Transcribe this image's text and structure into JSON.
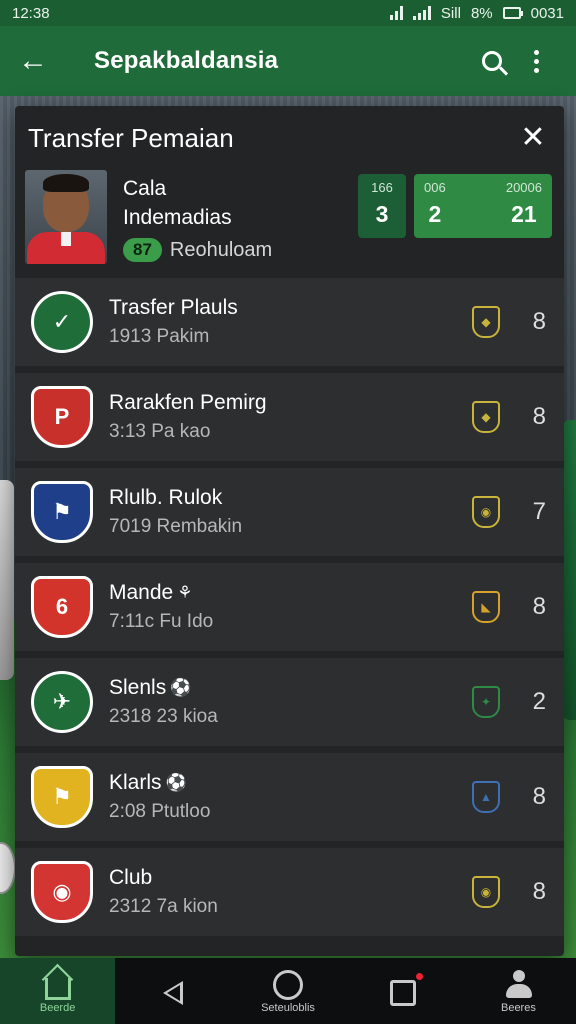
{
  "status": {
    "time": "12:38",
    "network": "Sill",
    "battery": "8%",
    "clock_right": "0031"
  },
  "appbar": {
    "title": "Sepakbaldansia"
  },
  "panel": {
    "title": "Transfer Pemaian",
    "player": {
      "name_line1": "Cala",
      "name_line2": "Indemadias",
      "rating": "87",
      "status": "Reohuloam"
    },
    "stats": [
      {
        "label": "166",
        "value": "3"
      },
      {
        "label": "006",
        "value": "2"
      },
      {
        "label": "20006",
        "value": "21"
      }
    ]
  },
  "clubs": [
    {
      "name": "Trasfer Plauls",
      "sub": "1913  Pakim",
      "num": "8",
      "emoji": "",
      "crest_color": "#1f6e3a",
      "crest_text": "✓",
      "mini_color": "#c8b43a"
    },
    {
      "name": "Rarakfen Pemirg",
      "sub": "3:13  Pa kao",
      "num": "8",
      "emoji": "",
      "crest_color": "#c8302c",
      "crest_text": "P",
      "mini_color": "#c8b43a"
    },
    {
      "name": "Rlulb. Rulok",
      "sub": "7019  Rembakin",
      "num": "7",
      "emoji": "",
      "crest_color": "#1f3f8a",
      "crest_text": "⚑",
      "mini_color": "#c8b43a"
    },
    {
      "name": "Mande",
      "sub": "7:11c  Fu Ido",
      "num": "8",
      "emoji": "⚘",
      "crest_color": "#d2342b",
      "crest_text": "6",
      "mini_color": "#d6a12a"
    },
    {
      "name": "Slenls",
      "sub": "2318  23 kioa",
      "num": "2",
      "emoji": "⚽",
      "crest_color": "#1f6e3a",
      "crest_text": "✈",
      "mini_color": "#2e8a45"
    },
    {
      "name": "Klarls",
      "sub": "2:08  Ptutloo",
      "num": "8",
      "emoji": "⚽",
      "crest_color": "#e2b320",
      "crest_text": "⚑",
      "mini_color": "#3f6fb5"
    },
    {
      "name": "Club",
      "sub": "2312  7a kion",
      "num": "8",
      "emoji": "",
      "crest_color": "#d23532",
      "crest_text": "◉",
      "mini_color": "#c8b43a"
    }
  ],
  "nav": {
    "home_label": "Beerde",
    "center_label": "Seteuloblis",
    "profile_label": "Beeres"
  }
}
